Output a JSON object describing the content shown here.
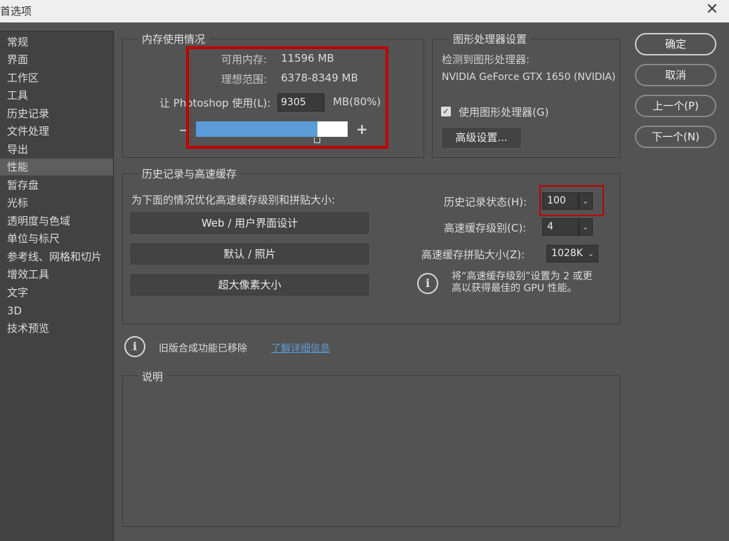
{
  "window": {
    "title": "首选项",
    "close_glyph": "✕"
  },
  "sidebar": {
    "items": [
      {
        "label": "常规",
        "active": false
      },
      {
        "label": "界面",
        "active": false
      },
      {
        "label": "工作区",
        "active": false
      },
      {
        "label": "工具",
        "active": false
      },
      {
        "label": "历史记录",
        "active": false
      },
      {
        "label": "文件处理",
        "active": false
      },
      {
        "label": "导出",
        "active": false
      },
      {
        "label": "性能",
        "active": true
      },
      {
        "label": "暂存盘",
        "active": false
      },
      {
        "label": "光标",
        "active": false
      },
      {
        "label": "透明度与色域",
        "active": false
      },
      {
        "label": "单位与标尺",
        "active": false
      },
      {
        "label": "参考线、网格和切片",
        "active": false
      },
      {
        "label": "增效工具",
        "active": false
      },
      {
        "label": "文字",
        "active": false
      },
      {
        "label": "3D",
        "active": false
      },
      {
        "label": "技术预览",
        "active": false
      }
    ]
  },
  "memory": {
    "title": "内存使用情况",
    "available_label": "可用内存:",
    "available_value": "11596 MB",
    "ideal_label": "理想范围:",
    "ideal_value": "6378-8349 MB",
    "use_label": "让 Photoshop 使用(L):",
    "use_value": "9305",
    "use_unit": "MB(80%)",
    "slider_percent": 80,
    "minus": "−",
    "plus": "+"
  },
  "gpu": {
    "title": "图形处理器设置",
    "detected_label": "检测到图形处理器:",
    "detected_value": "NVIDIA GeForce GTX 1650 (NVIDIA)",
    "use_gpu_label": "使用图形处理器(G)",
    "use_gpu_checked": true,
    "advanced_button": "高级设置..."
  },
  "history_cache": {
    "title": "历史记录与高速缓存",
    "optimize_label": "为下面的情况优化高速缓存级别和拼贴大小:",
    "preset_buttons": [
      "Web / 用户界面设计",
      "默认 / 照片",
      "超大像素大小"
    ],
    "history_states_label": "历史记录状态(H):",
    "history_states_value": "100",
    "cache_levels_label": "高速缓存级别(C):",
    "cache_levels_value": "4",
    "tile_size_label": "高速缓存拼贴大小(Z):",
    "tile_size_value": "1028K",
    "info_line1": "将“高速缓存级别”设置为 2 或更",
    "info_line2": "高以获得最佳的 GPU 性能。"
  },
  "legacy": {
    "text": "旧版合成功能已移除",
    "link": "了解详细信息"
  },
  "description": {
    "title": "说明"
  },
  "buttons": {
    "ok": "确定",
    "cancel": "取消",
    "prev": "上一个(P)",
    "next": "下一个(N)"
  },
  "colors": {
    "accent": "#5b9bd8",
    "highlight": "#c00000",
    "panel": "#535353"
  }
}
